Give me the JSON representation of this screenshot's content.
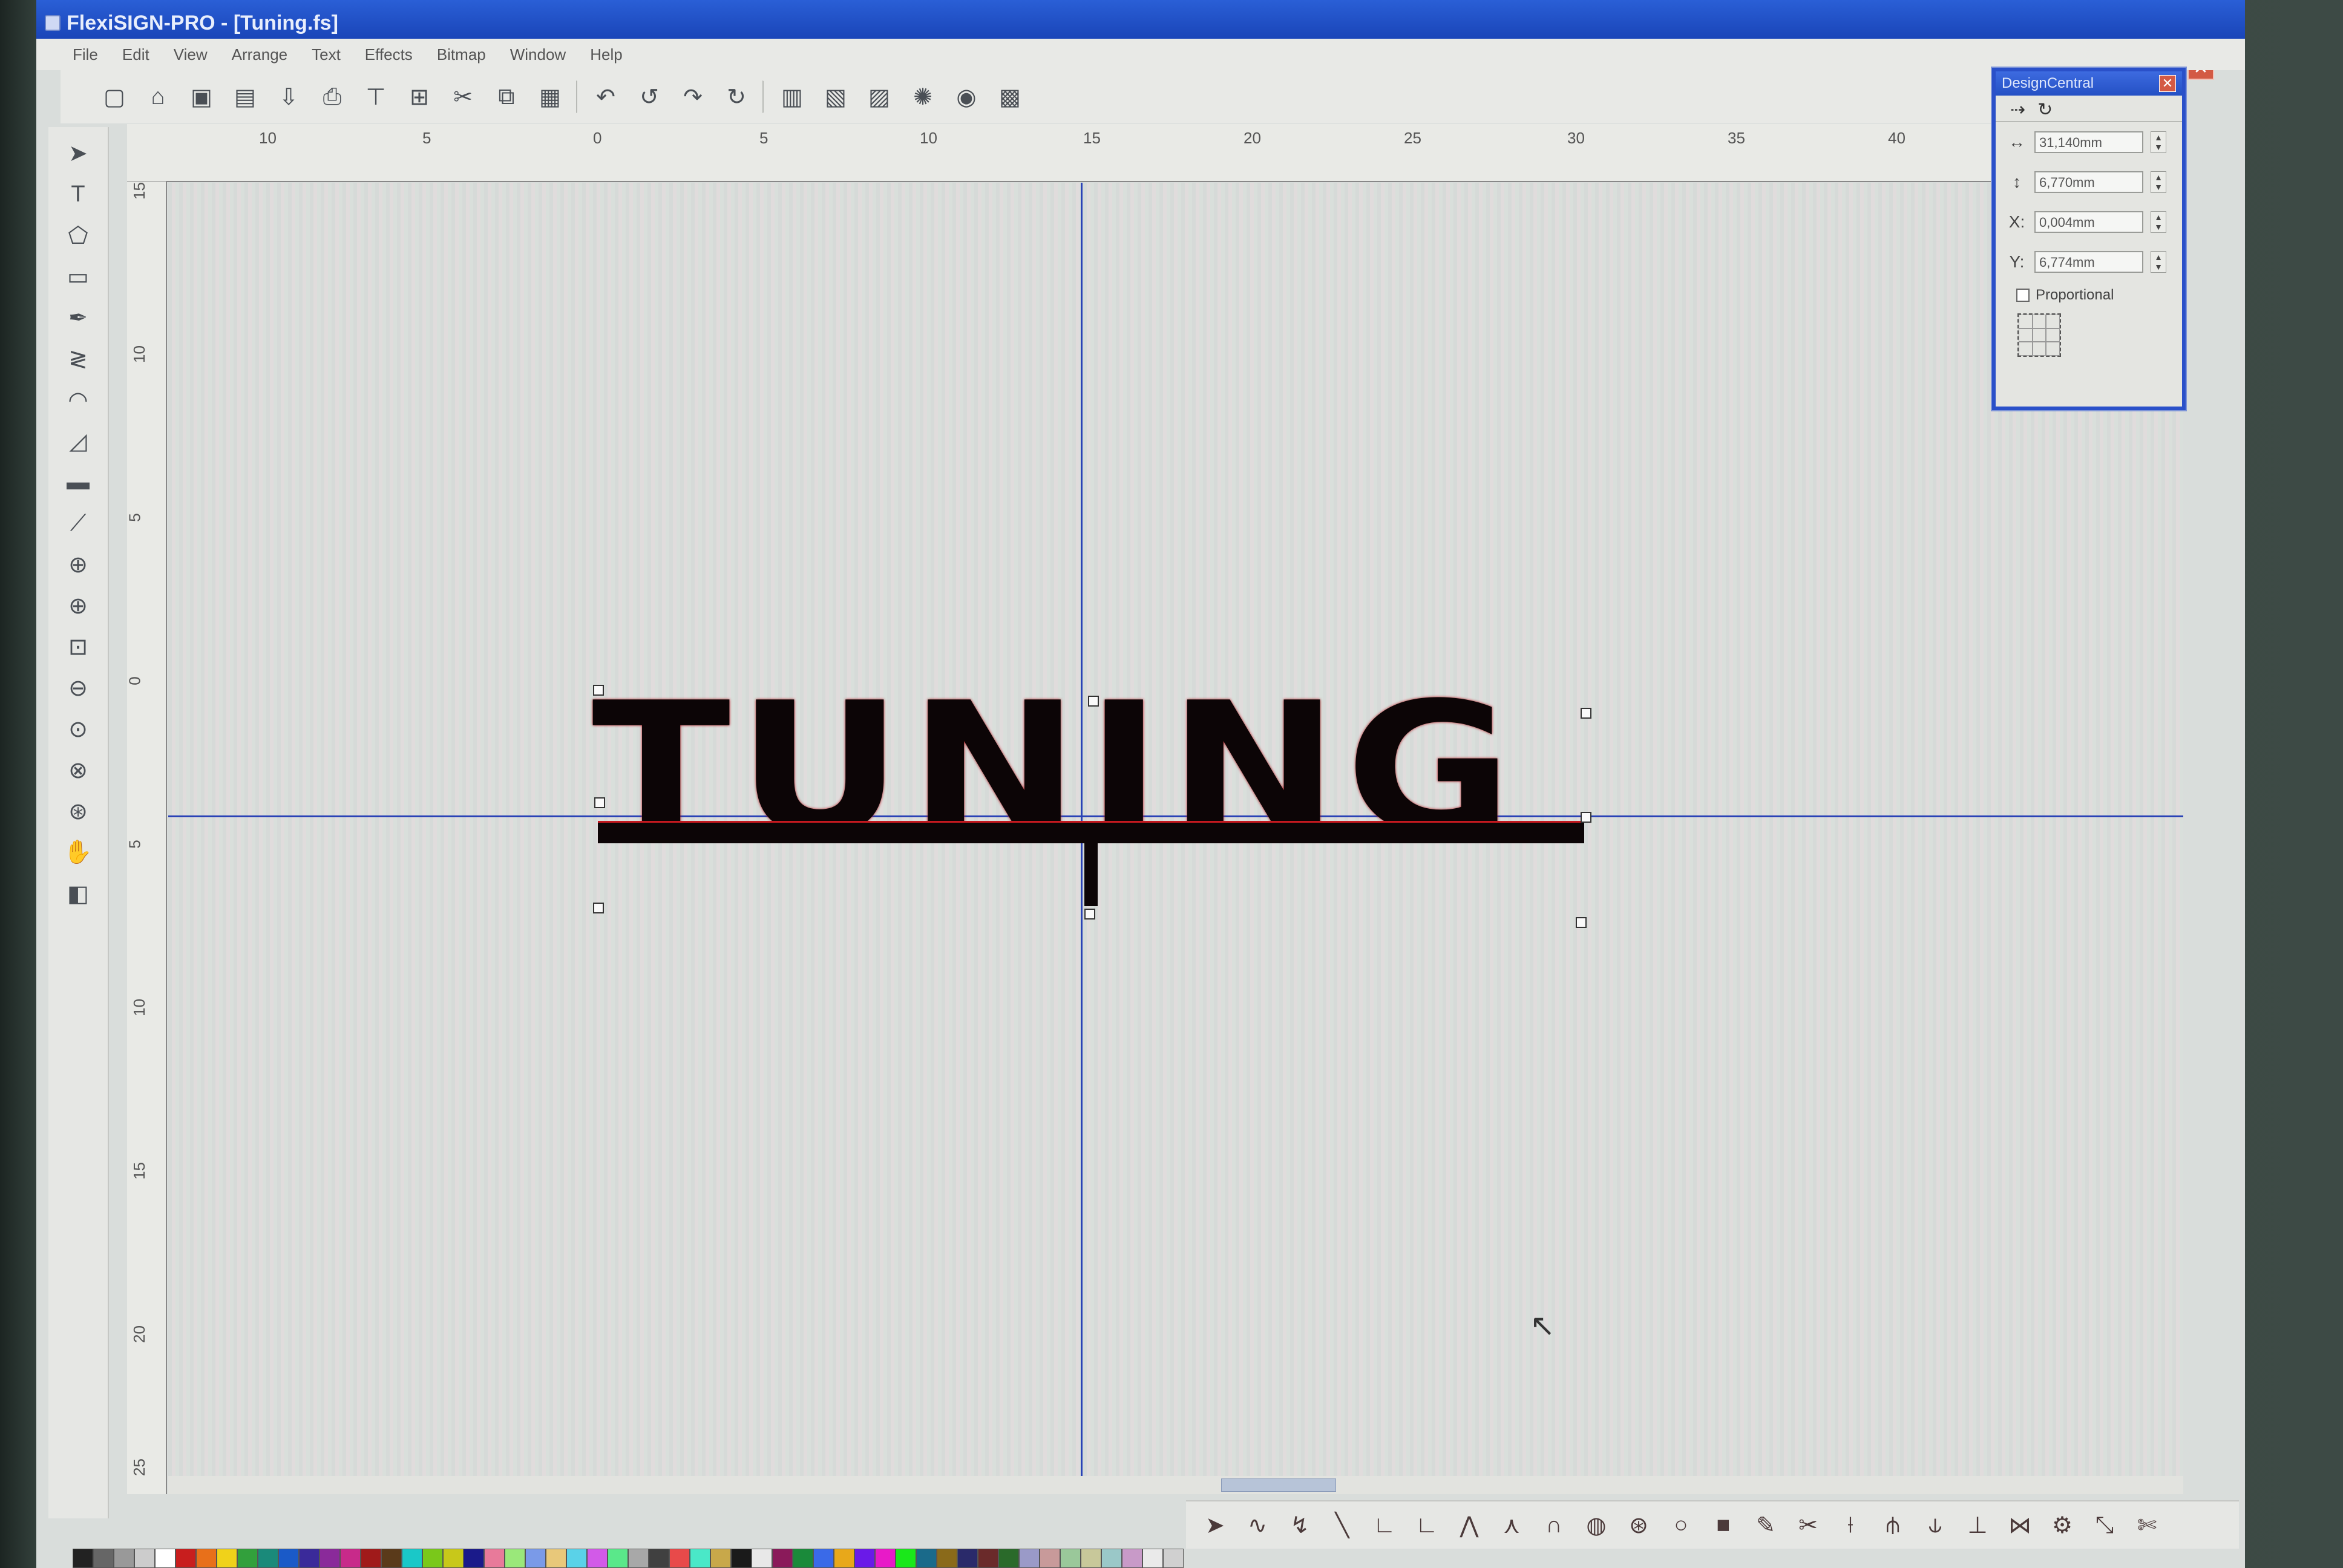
{
  "window": {
    "title": "FlexiSIGN-PRO - [Tuning.fs]"
  },
  "menu": [
    "File",
    "Edit",
    "View",
    "Arrange",
    "Text",
    "Effects",
    "Bitmap",
    "Window",
    "Help"
  ],
  "toolbar_icons": [
    "new-icon",
    "open-icon",
    "save-icon",
    "save-as-icon",
    "import-icon",
    "print-icon",
    "cut-output-icon",
    "output-icon",
    "scissors-icon",
    "copy-icon",
    "paste-icon",
    "undo-icon",
    "undo2-icon",
    "redo-icon",
    "redo2-icon",
    "layout-icon",
    "layout2-icon",
    "job-icon",
    "color-wheel-icon",
    "color-picker-icon",
    "palette-icon"
  ],
  "left_tools": [
    "select",
    "text",
    "shape",
    "rectangle",
    "pen",
    "zigzag",
    "arc",
    "eraser",
    "measure",
    "eyedropper",
    "zoom-area",
    "zoom-in",
    "zoom-page",
    "zoom-out",
    "zoom-pan",
    "zoom-fit",
    "zoom-selected",
    "hand",
    "fill"
  ],
  "rulers": {
    "horizontal": [
      "10",
      "5",
      "0",
      "5",
      "10",
      "15",
      "20",
      "25",
      "30",
      "35",
      "40"
    ],
    "vertical": [
      "15",
      "10",
      "5",
      "0",
      "5",
      "10",
      "15",
      "20",
      "25"
    ]
  },
  "canvas": {
    "logo_text": "TUNING"
  },
  "design_central": {
    "title": "DesignCentral",
    "width_value": "31,140mm",
    "height_value": "6,770mm",
    "x_label": "X:",
    "x_value": "0,004mm",
    "y_label": "Y:",
    "y_value": "6,774mm",
    "proportional_label": "Proportional"
  },
  "colors": {
    "title_blue": "#1a45b8",
    "guide_blue": "#2a42b6",
    "outline_red": "#c4191f"
  },
  "palette_colors": [
    "#222",
    "#666",
    "#999",
    "#ccc",
    "#fff",
    "#c81e1e",
    "#e8701a",
    "#f0d21a",
    "#32a03c",
    "#1a8a7a",
    "#1a5ac8",
    "#3a2a9a",
    "#8a2a9a",
    "#c82a8a",
    "#a01a1a",
    "#5a3a1a",
    "#1ac8c8",
    "#7ac81a",
    "#c8c81a",
    "#1a1a8a",
    "#e87a9a",
    "#9ae87a",
    "#7a9ae8",
    "#e8c87a",
    "#5ad2e8",
    "#d25ae8",
    "#5ae88a",
    "#a8a8a8",
    "#404040",
    "#e84a4a",
    "#4ae8c8",
    "#c8a84a",
    "#1a1a1a",
    "#e8e8e8",
    "#8a1a5a",
    "#1a8a3a",
    "#3a6ae8",
    "#e8a81a",
    "#6a1ae8",
    "#e81ac8",
    "#1ae81a",
    "#1a6a8a",
    "#8a6a1a",
    "#2a2a6a",
    "#6a2a2a",
    "#2a6a2a",
    "#9a9ac8",
    "#c89a9a",
    "#9ac89a",
    "#c8c89a",
    "#9ac8c8",
    "#c89ac8",
    "#eaeaea",
    "#d0d0d0"
  ],
  "bottom_tools": [
    "node-edit-icon",
    "smooth-icon",
    "curve-icon",
    "line-icon",
    "corner-icon",
    "corner2-icon",
    "break-icon",
    "join-icon",
    "arc-node-icon",
    "circle-node-icon",
    "tangent-icon",
    "round-icon",
    "fill-node-icon",
    "pen-node-icon",
    "cut-node-icon",
    "split-icon",
    "align-icon",
    "align2-icon",
    "distribute-icon",
    "mirror-icon",
    "weld-icon",
    "scale-icon",
    "scissors-node-icon"
  ]
}
